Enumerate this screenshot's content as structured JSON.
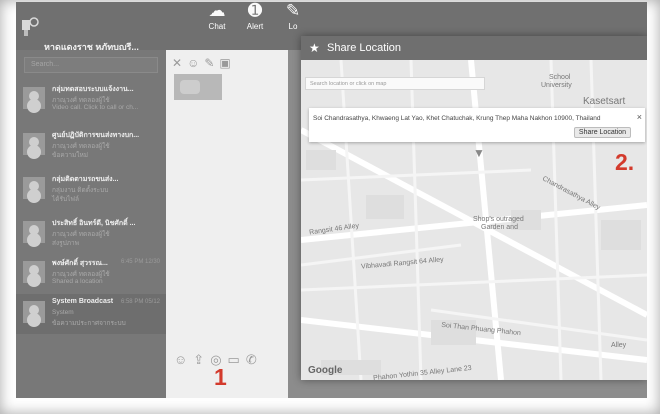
{
  "app": {
    "name": "หาดแดงราช หภัทบุญรี...",
    "colors": {
      "accent_red": "#d33a2c",
      "topbar": "#707070",
      "sidebar": "#787878"
    }
  },
  "topnav": [
    {
      "label": "Chat",
      "icon": "chat-bubble-icon"
    },
    {
      "label": "Alert",
      "icon": "alert-icon"
    },
    {
      "label": "Lo",
      "icon": "location-icon"
    }
  ],
  "sidebar": {
    "search_placeholder": "Search...",
    "chats": [
      {
        "title": "กลุ่มทดสอบระบบแจ้งงาน...",
        "sub1": "ภาณุวงศ์ ทดลองผู้ใช้",
        "sub2": "Video call. Click to call or ch...",
        "time": ""
      },
      {
        "title": "ศูนย์ปฏิบัติการขนส่งทางบก...",
        "sub1": "ภาณุวงศ์ ทดลองผู้ใช้",
        "sub2": "ข้อความใหม่",
        "time": ""
      },
      {
        "title": "กลุ่มติดตามรถขนส่ง...",
        "sub1": "กลุ่มงาน ติดตั้งระบบ",
        "sub2": "ได้รับไฟล์",
        "time": ""
      },
      {
        "title": "ประสิทธิ์ อินทร์ดี, นิชศักดิ์ ...",
        "sub1": "ภาณุวงศ์ ทดลองผู้ใช้",
        "sub2": "ส่งรูปภาพ",
        "time": ""
      },
      {
        "title": "พงษ์ศักดิ์ สุวรรณ...",
        "sub1": "ภาณุวงศ์ ทดลองผู้ใช้",
        "sub2": "Shared a location",
        "time": "6:45 PM 12/30"
      },
      {
        "title": "System Broadcast",
        "sub1": "System",
        "sub2": "ข้อความประกาศจากระบบ",
        "time": "6:58 PM 05/12"
      }
    ]
  },
  "annotations": {
    "step1": "1",
    "step2": "2."
  },
  "modal": {
    "title": "Share Location",
    "search_placeholder": "Search location or click on map",
    "address": "Soi Chandrasathya, Khwaeng Lat Yao, Khet Chatuchak, Krung Thep Maha Nakhon 10900, Thailand",
    "share_button": "Share Location",
    "close": "×",
    "map_labels": {
      "school": "School",
      "university": "University",
      "kasetsart": "Kasetsart",
      "shop": "Shop's outraged",
      "garden": "Garden and",
      "chandrasathya": "Chandrasathya Alley",
      "rangsit46": "Rangsit 46 Alley",
      "vibhavadi": "Vibhavadi Rangsit 64 Alley",
      "phuang": "Soi Than Phuang Phahon",
      "alley": "Alley",
      "kanlam": "Phahon Yothin 35 Alley Lane 23",
      "google": "Google"
    }
  }
}
